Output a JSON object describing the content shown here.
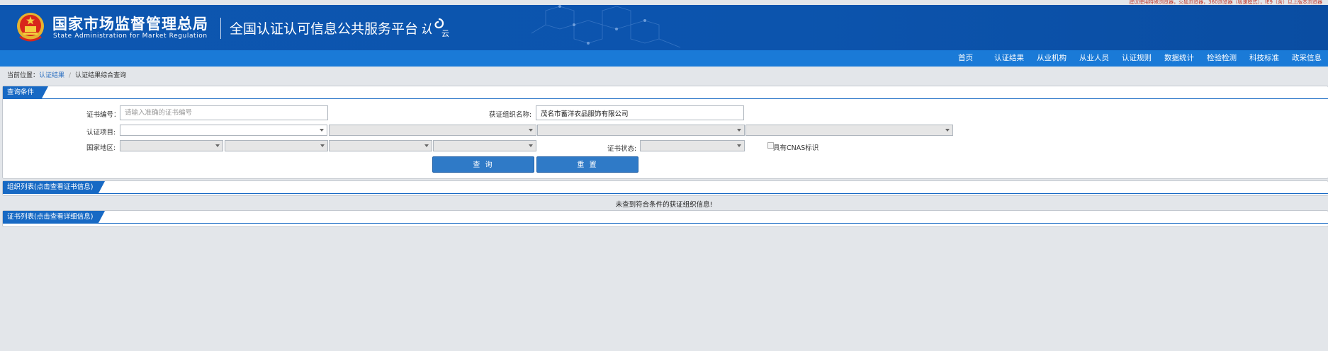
{
  "top_note": "建议使用特殊浏览器，火狐浏览器，360浏览器（极速模式），IE9（含）以上版本浏览器",
  "header": {
    "org_name_cn": "国家市场监督管理总局",
    "org_name_en": "State Administration  for  Market Regulation",
    "platform_title": "全国认证认可信息公共服务平台",
    "logo_text_a": "认",
    "logo_text_b": "云"
  },
  "nav": [
    "首页",
    "认证结果",
    "从业机构",
    "从业人员",
    "认证规则",
    "数据统计",
    "检验检测",
    "科技标准",
    "政采信息"
  ],
  "breadcrumb": {
    "prefix": "当前位置：",
    "link": "认证结果",
    "separator": "/",
    "current": "认证结果综合查询"
  },
  "query_panel": {
    "title": "查询条件",
    "cert_no_label": "证书编号：",
    "cert_no_placeholder": "请输入准确的证书编号",
    "org_name_label": "获证组织名称:",
    "org_name_value": "茂名市蓄洋农品服饰有限公司",
    "cert_item_label": "认证项目:",
    "region_label": "国家地区:",
    "cert_status_label": "证书状态:",
    "cnas_label": "具有CNAS标识",
    "search_button": "查 询",
    "reset_button": "重 置"
  },
  "org_list": {
    "title": "组织列表(点击查看证书信息)",
    "empty_message": "未查到符合条件的获证组织信息!"
  },
  "cert_list": {
    "title": "证书列表(点击查看详细信息)"
  },
  "colors": {
    "banner": "#0d56b0",
    "nav": "#1a7ad7",
    "panel_title": "#1769c4",
    "button": "#2f7ac7",
    "top_note": "#c0392b"
  },
  "icons": [
    "national-emblem-icon",
    "renzheng-cloud-logo",
    "chevron-down-icon"
  ]
}
